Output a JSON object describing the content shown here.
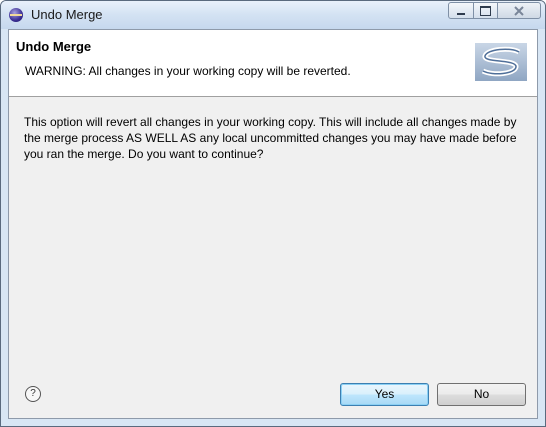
{
  "window": {
    "title": "Undo Merge",
    "colors": {
      "frame": "#d8e6f4",
      "client": "#f0f0f0",
      "default_button": "#bee6fd"
    }
  },
  "header": {
    "title": "Undo Merge",
    "message": "WARNING:  All changes in your working copy will be reverted.",
    "banner_icon": "subversion-logo-icon"
  },
  "body": {
    "message": "This option will revert all changes in your working copy.  This will include all changes made by the merge process AS WELL AS any local uncommitted changes you may have made before you ran the merge.  Do you want to continue?"
  },
  "footer": {
    "help_glyph": "?",
    "yes_label": "Yes",
    "no_label": "No"
  }
}
